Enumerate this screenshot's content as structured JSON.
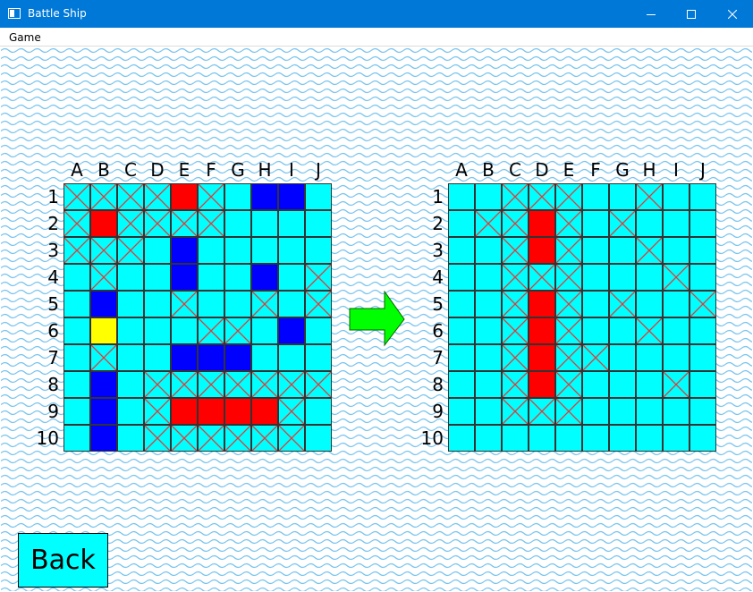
{
  "window": {
    "title": "Battle Ship",
    "title_bar_color": "#0078d7",
    "controls": [
      "minimize-icon",
      "maximize-icon",
      "close-icon"
    ]
  },
  "menu": {
    "items": [
      "Game"
    ]
  },
  "columns": [
    "A",
    "B",
    "C",
    "D",
    "E",
    "F",
    "G",
    "H",
    "I",
    "J"
  ],
  "rows": [
    "1",
    "2",
    "3",
    "4",
    "5",
    "6",
    "7",
    "8",
    "9",
    "10"
  ],
  "colors": {
    "water": "#00ffff",
    "ship": "#0000ff",
    "hit": "#ff0000",
    "selected": "#ffff00",
    "miss_mark": "#e53935",
    "arrow": "#00ff00",
    "wave": "#78c4ee"
  },
  "legend_codes": {
    "W": "water",
    "S": "ship",
    "H": "hit",
    "Y": "selected",
    "M": "miss (X mark)"
  },
  "boards": [
    {
      "name": "player-board",
      "grid": [
        [
          "M",
          "M",
          "M",
          "M",
          "H",
          "M",
          "W",
          "S",
          "S",
          "W"
        ],
        [
          "M",
          "H",
          "M",
          "M",
          "M",
          "M",
          "W",
          "W",
          "W",
          "W"
        ],
        [
          "M",
          "M",
          "M",
          "W",
          "S",
          "W",
          "W",
          "W",
          "W",
          "W"
        ],
        [
          "W",
          "M",
          "W",
          "W",
          "S",
          "W",
          "W",
          "S",
          "W",
          "M"
        ],
        [
          "W",
          "S",
          "W",
          "W",
          "M",
          "W",
          "W",
          "M",
          "W",
          "M"
        ],
        [
          "W",
          "Y",
          "W",
          "W",
          "W",
          "M",
          "M",
          "W",
          "S",
          "W"
        ],
        [
          "W",
          "M",
          "W",
          "W",
          "S",
          "S",
          "S",
          "W",
          "W",
          "W"
        ],
        [
          "W",
          "S",
          "W",
          "M",
          "M",
          "M",
          "M",
          "M",
          "M",
          "M"
        ],
        [
          "W",
          "S",
          "W",
          "M",
          "H",
          "H",
          "H",
          "H",
          "M",
          "W"
        ],
        [
          "W",
          "S",
          "W",
          "M",
          "M",
          "M",
          "M",
          "M",
          "M",
          "W"
        ]
      ]
    },
    {
      "name": "enemy-board",
      "grid": [
        [
          "W",
          "W",
          "M",
          "M",
          "M",
          "W",
          "W",
          "M",
          "W",
          "W"
        ],
        [
          "W",
          "M",
          "M",
          "H",
          "M",
          "W",
          "M",
          "W",
          "W",
          "W"
        ],
        [
          "W",
          "W",
          "M",
          "H",
          "M",
          "W",
          "W",
          "M",
          "W",
          "W"
        ],
        [
          "W",
          "W",
          "M",
          "M",
          "M",
          "W",
          "W",
          "W",
          "M",
          "W"
        ],
        [
          "W",
          "W",
          "M",
          "H",
          "M",
          "W",
          "M",
          "W",
          "W",
          "M"
        ],
        [
          "W",
          "W",
          "M",
          "H",
          "M",
          "W",
          "W",
          "M",
          "W",
          "W"
        ],
        [
          "W",
          "W",
          "M",
          "H",
          "M",
          "M",
          "W",
          "W",
          "W",
          "W"
        ],
        [
          "W",
          "W",
          "M",
          "H",
          "M",
          "W",
          "W",
          "W",
          "M",
          "W"
        ],
        [
          "W",
          "W",
          "M",
          "M",
          "M",
          "W",
          "W",
          "W",
          "W",
          "W"
        ],
        [
          "W",
          "W",
          "W",
          "W",
          "W",
          "W",
          "W",
          "W",
          "W",
          "W"
        ]
      ]
    }
  ],
  "direction_icon": "right-arrow-icon",
  "back_button": {
    "label": "Back"
  }
}
